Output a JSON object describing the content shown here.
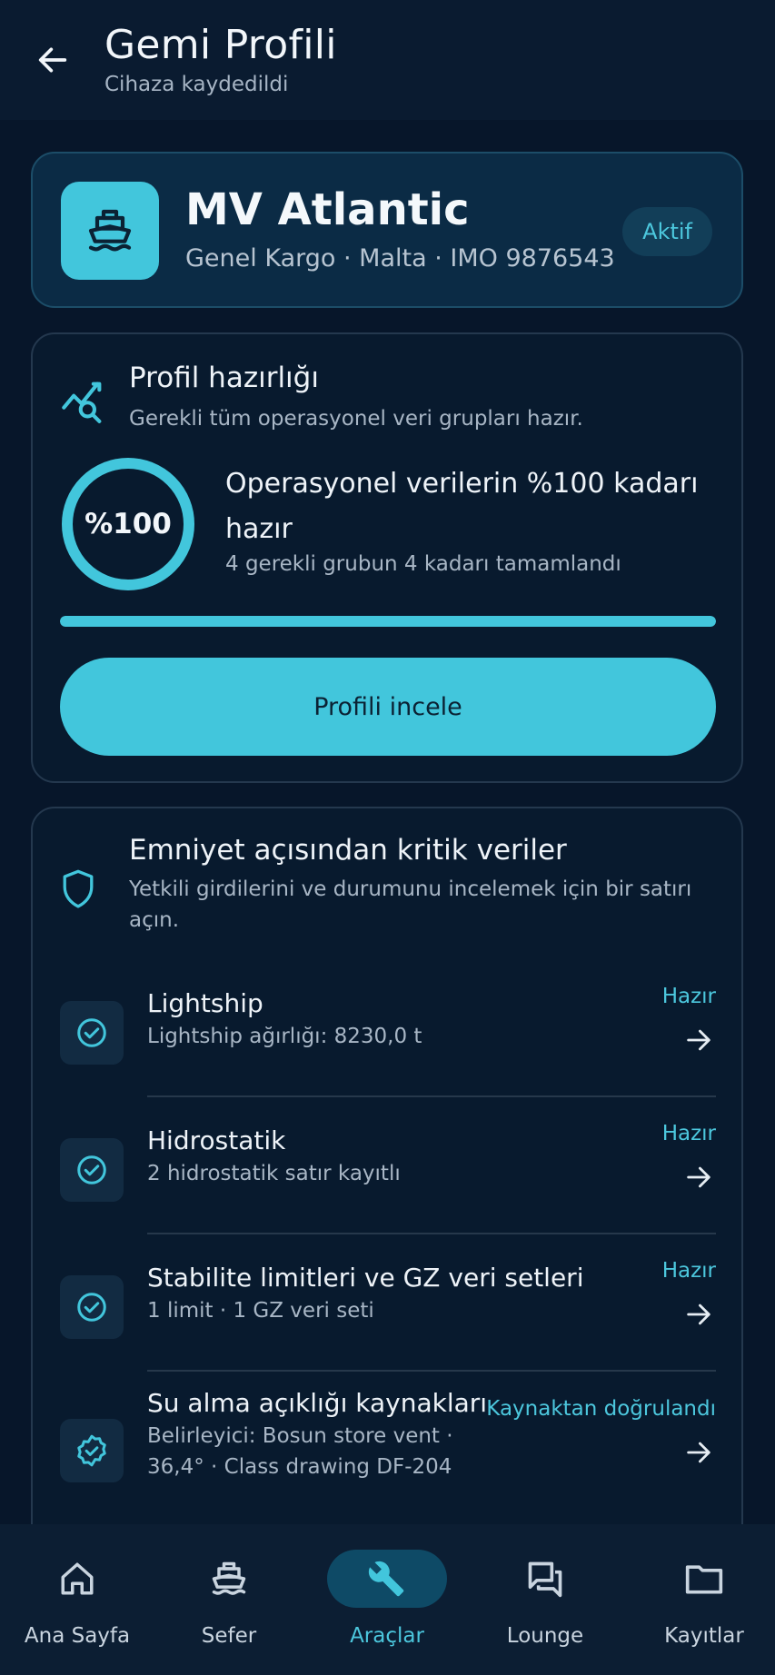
{
  "header": {
    "title": "Gemi Profili",
    "subtitle": "Cihaza kaydedildi",
    "back_icon": "arrow-left-icon"
  },
  "vessel": {
    "name": "MV Atlantic",
    "meta": "Genel Kargo · Malta · IMO 9876543",
    "status": "Aktif",
    "icon": "ship-icon"
  },
  "readiness": {
    "title": "Profil hazırlığı",
    "subtitle": "Gerekli tüm operasyonel veri grupları hazır.",
    "percent_label": "%100",
    "percent": 100,
    "summary": "Operasyonel verilerin %100 kadarı hazır",
    "detail": "4 gerekli grubun 4 kadarı tamamlandı",
    "button": "Profili incele",
    "icon": "chart-search-icon"
  },
  "safety": {
    "title": "Emniyet açısından kritik veriler",
    "subtitle": "Yetkili girdilerini ve durumunu incelemek için bir satırı açın.",
    "icon": "shield-icon",
    "rows": [
      {
        "title": "Lightship",
        "sub": "Lightship ağırlığı: 8230,0 t",
        "status": "Hazır"
      },
      {
        "title": "Hidrostatik",
        "sub": "2 hidrostatik satır kayıtlı",
        "status": "Hazır"
      },
      {
        "title": "Stabilite limitleri ve GZ veri setleri",
        "sub": "1 limit · 1 GZ veri seti",
        "status": "Hazır"
      },
      {
        "title": "Su alma açıklığı kaynakları",
        "sub": "Belirleyici: Bosun store vent · 36,4° · Class drawing DF-204",
        "status": "Kaynaktan doğrulandı"
      }
    ]
  },
  "nav": {
    "items": [
      {
        "label": "Ana Sayfa",
        "icon": "home-icon"
      },
      {
        "label": "Sefer",
        "icon": "ship-icon"
      },
      {
        "label": "Araçlar",
        "icon": "wrench-icon",
        "active": true
      },
      {
        "label": "Lounge",
        "icon": "chat-icon"
      },
      {
        "label": "Kayıtlar",
        "icon": "folder-icon"
      }
    ]
  },
  "colors": {
    "background": "#07162a",
    "accent": "#42c6dc",
    "card": "#081a2e"
  }
}
